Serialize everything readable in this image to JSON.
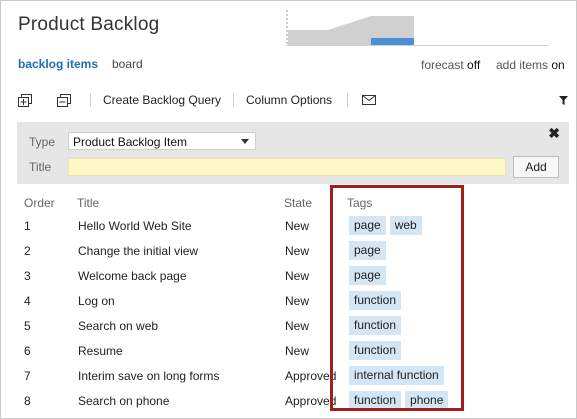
{
  "header": {
    "title": "Product Backlog",
    "nav": {
      "active": "backlog items",
      "other": "board"
    },
    "forecast_label": "forecast",
    "forecast_value": "off",
    "add_items_label": "add items",
    "add_items_value": "on"
  },
  "toolbar": {
    "create_query": "Create Backlog Query",
    "column_options": "Column Options"
  },
  "form": {
    "type_label": "Type",
    "type_value": "Product Backlog Item",
    "title_label": "Title",
    "title_value": "",
    "add_label": "Add"
  },
  "table": {
    "headers": {
      "order": "Order",
      "title": "Title",
      "state": "State",
      "tags": "Tags"
    },
    "rows": [
      {
        "order": "1",
        "title": "Hello World Web Site",
        "state": "New",
        "tags": [
          "page",
          "web"
        ]
      },
      {
        "order": "2",
        "title": "Change the initial view",
        "state": "New",
        "tags": [
          "page"
        ]
      },
      {
        "order": "3",
        "title": "Welcome back page",
        "state": "New",
        "tags": [
          "page"
        ]
      },
      {
        "order": "4",
        "title": "Log on",
        "state": "New",
        "tags": [
          "function"
        ]
      },
      {
        "order": "5",
        "title": "Search on web",
        "state": "New",
        "tags": [
          "function"
        ]
      },
      {
        "order": "6",
        "title": "Resume",
        "state": "New",
        "tags": [
          "function"
        ]
      },
      {
        "order": "7",
        "title": "Interim save on long forms",
        "state": "Approved",
        "tags": [
          "internal function"
        ]
      },
      {
        "order": "8",
        "title": "Search on phone",
        "state": "Approved",
        "tags": [
          "function",
          "phone"
        ]
      }
    ]
  },
  "colors": {
    "accent": "#1f6fb5",
    "tag_bg": "#d4e5f4",
    "title_input_bg": "#fdf8c5",
    "highlight_border": "#a31d1d",
    "chart_gray": "#d0d0d0",
    "chart_blue": "#4a90d9"
  }
}
